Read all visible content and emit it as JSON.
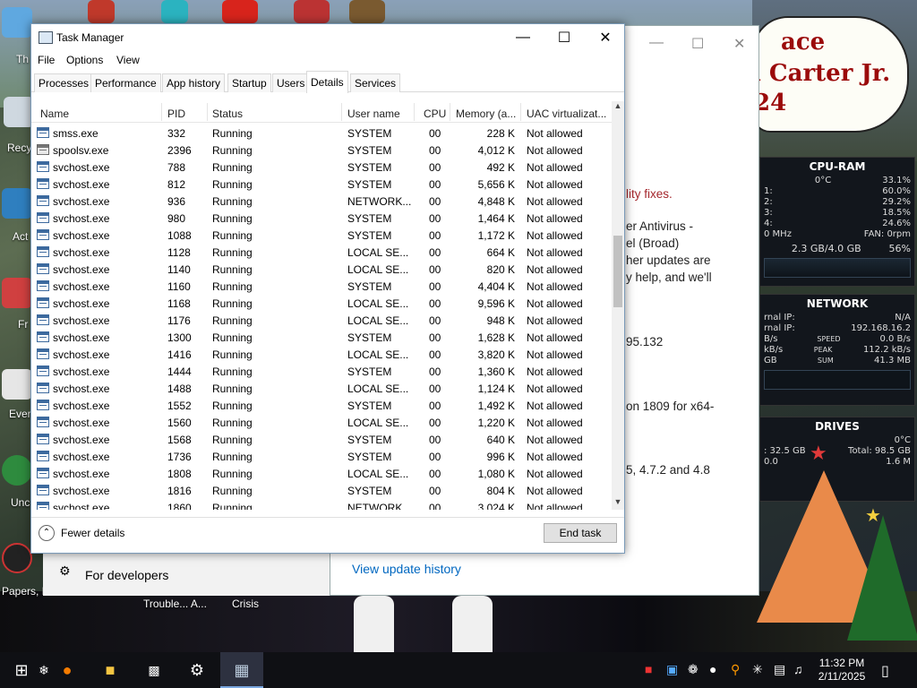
{
  "desktop": {
    "icon_labels": [
      "Th",
      "Recy",
      "Act",
      "Fr",
      "Ever",
      "Unc",
      "Papers, P"
    ],
    "bottom_labels": [
      "Trouble... A...",
      "Crisis"
    ],
    "poster_lines": [
      "ace",
      "l Carter Jr.",
      "24"
    ]
  },
  "background_window": {
    "lines": [
      "lity fixes.",
      "er Antivirus -",
      "el (Broad)",
      "her updates are",
      "y help, and we'll",
      "95.132",
      "on 1809 for x64-",
      "5, 4.7.2 and 4.8"
    ],
    "link": "View update history",
    "developers": "For developers"
  },
  "gadgets": {
    "cpu": {
      "title": "CPU-RAM",
      "temp": "0°C",
      "total": "33.1%",
      "cores": [
        {
          "label": "1:",
          "value": "60.0%"
        },
        {
          "label": "2:",
          "value": "29.2%"
        },
        {
          "label": "3:",
          "value": "18.5%"
        },
        {
          "label": "4:",
          "value": "24.6%"
        }
      ],
      "freq": "0 MHz",
      "fan": "FAN: 0rpm",
      "ram": "2.3 GB/4.0 GB",
      "ram_pct": "56%"
    },
    "network": {
      "title": "NETWORK",
      "internal_label": "rnal IP:",
      "internal_value": "N/A",
      "external_label": "rnal IP:",
      "external_value": "192.168.16.2",
      "speed_label": "SPEED",
      "speed_value": "0.0 B/s",
      "peak_label": "PEAK",
      "peak_value": "112.2 kB/s",
      "sum_label": "SUM",
      "sum_value": "41.3 MB",
      "left_vals": [
        "B/s",
        "kB/s",
        "GB"
      ]
    },
    "drives": {
      "title": "DRIVES",
      "temp": "0°C",
      "free": ": 32.5 GB",
      "total": "Total: 98.5 GB",
      "read": "0.0",
      "write": "1.6 M"
    }
  },
  "task_manager": {
    "title": "Task Manager",
    "menu": [
      "File",
      "Options",
      "View"
    ],
    "tabs": [
      "Processes",
      "Performance",
      "App history",
      "Startup",
      "Users",
      "Details",
      "Services"
    ],
    "active_tab": "Details",
    "columns": [
      "Name",
      "PID",
      "Status",
      "User name",
      "CPU",
      "Memory (a...",
      "UAC virtualizat..."
    ],
    "rows": [
      {
        "name": "smss.exe",
        "pid": "332",
        "status": "Running",
        "user": "SYSTEM",
        "cpu": "00",
        "mem": "228 K",
        "uac": "Not allowed"
      },
      {
        "name": "spoolsv.exe",
        "pid": "2396",
        "status": "Running",
        "user": "SYSTEM",
        "cpu": "00",
        "mem": "4,012 K",
        "uac": "Not allowed"
      },
      {
        "name": "svchost.exe",
        "pid": "788",
        "status": "Running",
        "user": "SYSTEM",
        "cpu": "00",
        "mem": "492 K",
        "uac": "Not allowed"
      },
      {
        "name": "svchost.exe",
        "pid": "812",
        "status": "Running",
        "user": "SYSTEM",
        "cpu": "00",
        "mem": "5,656 K",
        "uac": "Not allowed"
      },
      {
        "name": "svchost.exe",
        "pid": "936",
        "status": "Running",
        "user": "NETWORK...",
        "cpu": "00",
        "mem": "4,848 K",
        "uac": "Not allowed"
      },
      {
        "name": "svchost.exe",
        "pid": "980",
        "status": "Running",
        "user": "SYSTEM",
        "cpu": "00",
        "mem": "1,464 K",
        "uac": "Not allowed"
      },
      {
        "name": "svchost.exe",
        "pid": "1088",
        "status": "Running",
        "user": "SYSTEM",
        "cpu": "00",
        "mem": "1,172 K",
        "uac": "Not allowed"
      },
      {
        "name": "svchost.exe",
        "pid": "1128",
        "status": "Running",
        "user": "LOCAL SE...",
        "cpu": "00",
        "mem": "664 K",
        "uac": "Not allowed"
      },
      {
        "name": "svchost.exe",
        "pid": "1140",
        "status": "Running",
        "user": "LOCAL SE...",
        "cpu": "00",
        "mem": "820 K",
        "uac": "Not allowed"
      },
      {
        "name": "svchost.exe",
        "pid": "1160",
        "status": "Running",
        "user": "SYSTEM",
        "cpu": "00",
        "mem": "4,404 K",
        "uac": "Not allowed"
      },
      {
        "name": "svchost.exe",
        "pid": "1168",
        "status": "Running",
        "user": "LOCAL SE...",
        "cpu": "00",
        "mem": "9,596 K",
        "uac": "Not allowed"
      },
      {
        "name": "svchost.exe",
        "pid": "1176",
        "status": "Running",
        "user": "LOCAL SE...",
        "cpu": "00",
        "mem": "948 K",
        "uac": "Not allowed"
      },
      {
        "name": "svchost.exe",
        "pid": "1300",
        "status": "Running",
        "user": "SYSTEM",
        "cpu": "00",
        "mem": "1,628 K",
        "uac": "Not allowed"
      },
      {
        "name": "svchost.exe",
        "pid": "1416",
        "status": "Running",
        "user": "LOCAL SE...",
        "cpu": "00",
        "mem": "3,820 K",
        "uac": "Not allowed"
      },
      {
        "name": "svchost.exe",
        "pid": "1444",
        "status": "Running",
        "user": "SYSTEM",
        "cpu": "00",
        "mem": "1,360 K",
        "uac": "Not allowed"
      },
      {
        "name": "svchost.exe",
        "pid": "1488",
        "status": "Running",
        "user": "LOCAL SE...",
        "cpu": "00",
        "mem": "1,124 K",
        "uac": "Not allowed"
      },
      {
        "name": "svchost.exe",
        "pid": "1552",
        "status": "Running",
        "user": "SYSTEM",
        "cpu": "00",
        "mem": "1,492 K",
        "uac": "Not allowed"
      },
      {
        "name": "svchost.exe",
        "pid": "1560",
        "status": "Running",
        "user": "LOCAL SE...",
        "cpu": "00",
        "mem": "1,220 K",
        "uac": "Not allowed"
      },
      {
        "name": "svchost.exe",
        "pid": "1568",
        "status": "Running",
        "user": "SYSTEM",
        "cpu": "00",
        "mem": "640 K",
        "uac": "Not allowed"
      },
      {
        "name": "svchost.exe",
        "pid": "1736",
        "status": "Running",
        "user": "SYSTEM",
        "cpu": "00",
        "mem": "996 K",
        "uac": "Not allowed"
      },
      {
        "name": "svchost.exe",
        "pid": "1808",
        "status": "Running",
        "user": "LOCAL SE...",
        "cpu": "00",
        "mem": "1,080 K",
        "uac": "Not allowed"
      },
      {
        "name": "svchost.exe",
        "pid": "1816",
        "status": "Running",
        "user": "SYSTEM",
        "cpu": "00",
        "mem": "804 K",
        "uac": "Not allowed"
      },
      {
        "name": "svchost.exe",
        "pid": "1860",
        "status": "Running",
        "user": "NETWORK...",
        "cpu": "00",
        "mem": "3,024 K",
        "uac": "Not allowed"
      }
    ],
    "fewer_details": "Fewer details",
    "end_task": "End task"
  },
  "taskbar": {
    "time": "11:32 PM",
    "date": "2/11/2025"
  },
  "colors": {
    "accent": "#0078d7",
    "poster_red": "#9b0b0b"
  }
}
